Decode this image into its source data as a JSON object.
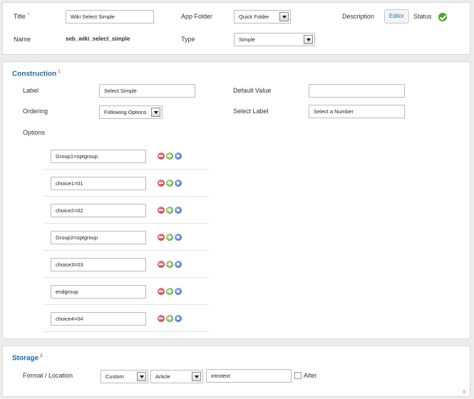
{
  "top": {
    "title_label": "Title",
    "required_mark": "*",
    "title_value": "Wiki Select Simple",
    "app_folder_label": "App Folder",
    "app_folder_value": "Quick Folder",
    "description_label": "Description",
    "editor_button": "Editor",
    "status_label": "Status",
    "status_icon": "check-circle-icon",
    "name_label": "Name",
    "name_value": "seb_wiki_select_simple",
    "type_label": "Type",
    "type_value": "Simple"
  },
  "construction": {
    "title": "Construction",
    "badge": "1",
    "label_label": "Label",
    "label_value": "Select Simple",
    "default_value_label": "Default Value",
    "default_value_value": "",
    "ordering_label": "Ordering",
    "ordering_value": "Following Options",
    "select_label_label": "Select Label",
    "select_label_value": "Select a Number",
    "options_label": "Options",
    "options": [
      {
        "value": "Group1=optgroup"
      },
      {
        "value": "choice1=01"
      },
      {
        "value": "choice2=02"
      },
      {
        "value": "Group2=optgroup"
      },
      {
        "value": "choice3=03"
      },
      {
        "value": "endgroup"
      },
      {
        "value": "choice4=04"
      }
    ],
    "row_icons": [
      "remove-icon",
      "add-icon",
      "move-icon"
    ]
  },
  "storage": {
    "title": "Storage",
    "badge": "2",
    "format_location_label": "Format / Location",
    "format_value": "Custom",
    "location_value": "Article",
    "field_value": "introtext",
    "alter_label": "Alter",
    "alter_checked": false,
    "corner_mark": "8"
  },
  "colors": {
    "section_title": "#1d67a8",
    "required": "#e05a1a",
    "status_ok": "#4ca62a"
  }
}
